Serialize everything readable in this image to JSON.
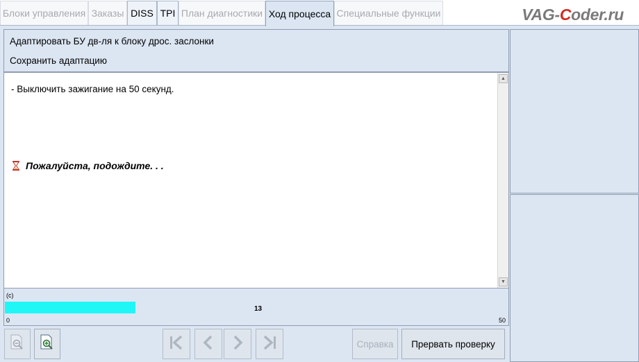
{
  "tabs": [
    {
      "label": "Блоки управления",
      "state": "disabled"
    },
    {
      "label": "Заказы",
      "state": "disabled"
    },
    {
      "label": "DISS",
      "state": "enabled"
    },
    {
      "label": "TPI",
      "state": "enabled"
    },
    {
      "label": "План диагностики",
      "state": "disabled"
    },
    {
      "label": "Ход процесса",
      "state": "active"
    },
    {
      "label": "Специальные функции",
      "state": "disabled"
    }
  ],
  "watermark": {
    "prefix": "VAG-",
    "accent": "C",
    "suffix": "oder.ru"
  },
  "header": {
    "line1": "Адаптировать БУ дв-ля к блоку дрос. заслонки",
    "line2": "Сохранить адаптацию"
  },
  "content": {
    "instruction": "- Выключить зажигание на 50 секунд.",
    "wait_text": "Пожалуйста, подождите. . ."
  },
  "progress": {
    "label": "(c)",
    "value": 13,
    "min_label": "0",
    "max_label": "50",
    "min": 0,
    "max": 50,
    "fill_color": "#1ff7f7"
  },
  "icons": {
    "zoom_out": "zoom-out-icon",
    "zoom_in": "zoom-in-icon",
    "first": "first-page-icon",
    "prev": "previous-icon",
    "next": "next-icon",
    "last": "last-page-icon",
    "hourglass": "hourglass-icon"
  },
  "buttons": {
    "help": "Справка",
    "abort": "Прервать проверку"
  },
  "colors": {
    "background": "#dce6f3",
    "accent_red": "#d42b24"
  }
}
